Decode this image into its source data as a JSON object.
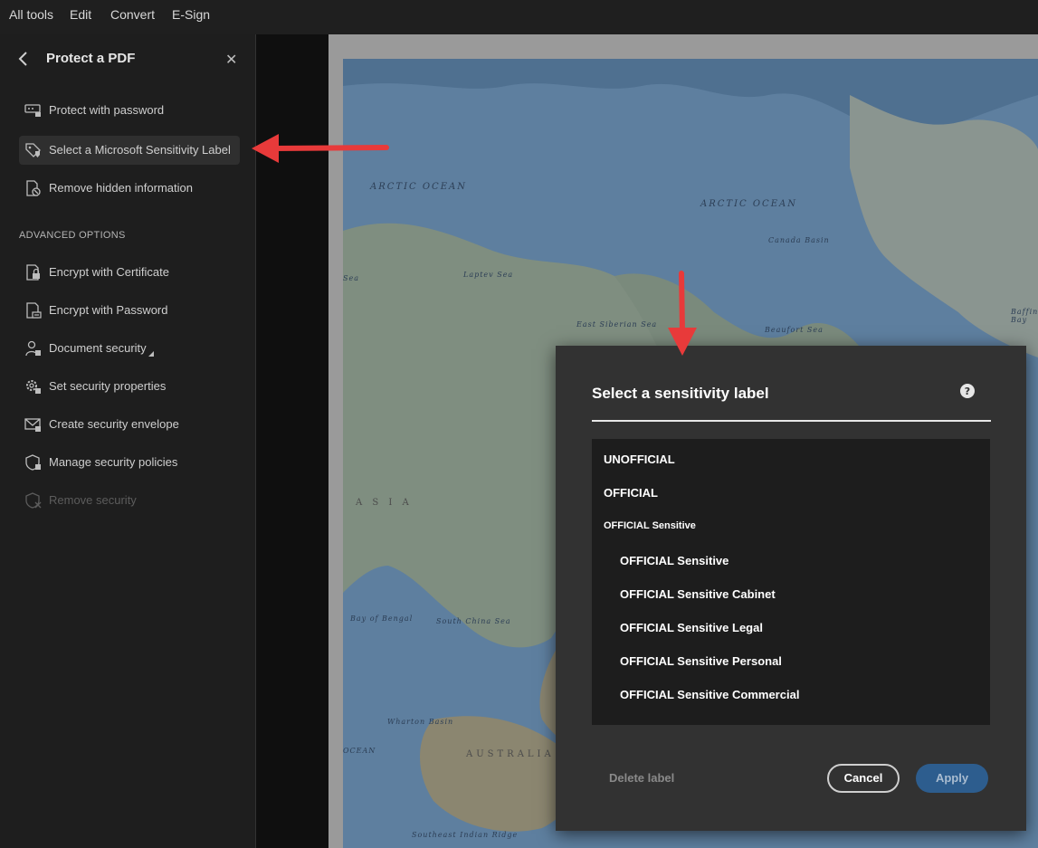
{
  "menubar": {
    "items": [
      "All tools",
      "Edit",
      "Convert",
      "E-Sign"
    ]
  },
  "sidebar": {
    "title": "Protect a PDF",
    "items": [
      {
        "label": "Protect with password",
        "icon": "password-field-icon"
      },
      {
        "label": "Select a Microsoft Sensitivity Label",
        "icon": "shield-tag-icon"
      },
      {
        "label": "Remove hidden information",
        "icon": "document-remove-icon"
      }
    ],
    "section_heading": "ADVANCED OPTIONS",
    "advanced_items": [
      {
        "label": "Encrypt with Certificate",
        "icon": "certificate-lock-icon"
      },
      {
        "label": "Encrypt with Password",
        "icon": "password-lock-icon"
      },
      {
        "label": "Document security",
        "icon": "user-lock-icon"
      },
      {
        "label": "Set security properties",
        "icon": "gear-lock-icon"
      },
      {
        "label": "Create security envelope",
        "icon": "envelope-lock-icon"
      },
      {
        "label": "Manage security policies",
        "icon": "shield-policy-icon"
      },
      {
        "label": "Remove security",
        "icon": "shield-remove-icon"
      }
    ]
  },
  "map": {
    "labels": [
      "ARCTIC OCEAN",
      "ARCTIC OCEAN",
      "Canada Basin",
      "Laptev Sea",
      "East Siberian Sea",
      "Beaufort Sea",
      "Baffin Bay",
      "A S I A",
      "AUSTRALIA",
      "OCEAN",
      "Bay of Bengal",
      "South China Sea",
      "Wharton Basin",
      "Southeast Indian Ridge",
      "Sea"
    ]
  },
  "dialog": {
    "title": "Select a sensitivity label",
    "options": [
      {
        "label": "UNOFFICIAL",
        "kind": "top"
      },
      {
        "label": "OFFICIAL",
        "kind": "top"
      },
      {
        "label": "OFFICIAL Sensitive",
        "kind": "group"
      },
      {
        "label": "OFFICIAL Sensitive",
        "kind": "sub"
      },
      {
        "label": "OFFICIAL Sensitive Cabinet",
        "kind": "sub"
      },
      {
        "label": "OFFICIAL Sensitive Legal",
        "kind": "sub"
      },
      {
        "label": "OFFICIAL Sensitive Personal",
        "kind": "sub"
      },
      {
        "label": "OFFICIAL Sensitive Commercial",
        "kind": "sub"
      }
    ],
    "delete_label": "Delete label",
    "cancel_label": "Cancel",
    "apply_label": "Apply"
  },
  "colors": {
    "accent_arrow": "#e83a3a",
    "apply_button": "#2d5d8e",
    "dialog_bg": "#323232",
    "sidebar_bg": "#1e1e1e"
  }
}
